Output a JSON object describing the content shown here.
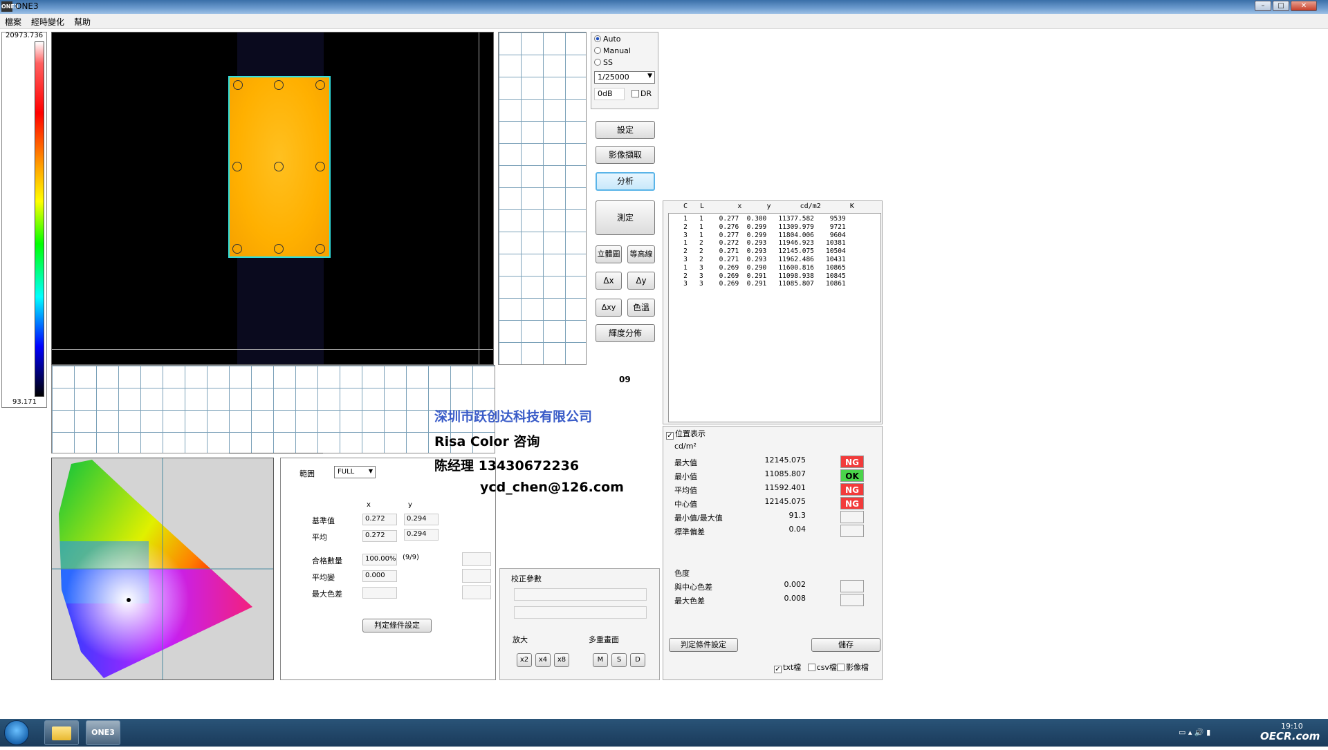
{
  "window": {
    "title": "ONE3",
    "icon": "ONE3"
  },
  "menu": [
    "檔案",
    "經時變化",
    "幫助"
  ],
  "scale": {
    "max": "20973.736",
    "min": "93.171"
  },
  "exposure": {
    "modes": [
      "Auto",
      "Manual",
      "SS"
    ],
    "selected_mode": "Auto",
    "shutter": "1/25000",
    "gain": "0dB",
    "dr_label": "DR"
  },
  "buttons": {
    "settings": "設定",
    "capture": "影像擷取",
    "analyze": "分析",
    "measure": "測定",
    "solid": "立體圖",
    "contour": "等高線",
    "dx": "Δx",
    "dy": "Δy",
    "dxy": "Δxy",
    "color_temp": "色溫",
    "lum_dist": "輝度分佈"
  },
  "count_label": "09",
  "table": {
    "headers": [
      "C",
      "L",
      "x",
      "y",
      "cd/m2",
      "K"
    ],
    "rows": [
      [
        "1",
        "1",
        "0.277",
        "0.300",
        "11377.582",
        "9539"
      ],
      [
        "2",
        "1",
        "0.276",
        "0.299",
        "11309.979",
        "9721"
      ],
      [
        "3",
        "1",
        "0.277",
        "0.299",
        "11804.006",
        "9604"
      ],
      [
        "1",
        "2",
        "0.272",
        "0.293",
        "11946.923",
        "10381"
      ],
      [
        "2",
        "2",
        "0.271",
        "0.293",
        "12145.075",
        "10504"
      ],
      [
        "3",
        "2",
        "0.271",
        "0.293",
        "11962.486",
        "10431"
      ],
      [
        "1",
        "3",
        "0.269",
        "0.290",
        "11600.816",
        "10865"
      ],
      [
        "2",
        "3",
        "0.269",
        "0.291",
        "11098.938",
        "10845"
      ],
      [
        "3",
        "3",
        "0.269",
        "0.291",
        "11085.807",
        "10861"
      ]
    ]
  },
  "stats": {
    "position_display": "位置表示",
    "unit": "cd/m²",
    "rows": [
      {
        "label": "最大值",
        "value": "12145.075",
        "status": "NG"
      },
      {
        "label": "最小值",
        "value": "11085.807",
        "status": "OK"
      },
      {
        "label": "平均值",
        "value": "11592.401",
        "status": "NG"
      },
      {
        "label": "中心值",
        "value": "12145.075",
        "status": "NG"
      },
      {
        "label": "最小值/最大值",
        "value": "91.3",
        "status": ""
      },
      {
        "label": "標準偏差",
        "value": "0.04",
        "status": ""
      }
    ],
    "chroma_title": "色度",
    "chroma_rows": [
      {
        "label": "與中心色差",
        "value": "0.002"
      },
      {
        "label": "最大色差",
        "value": "0.008"
      }
    ],
    "judge_button": "判定條件設定",
    "save_button": "儲存",
    "check_txt": "txt檔",
    "check_csv": "csv檔",
    "check_img": "影像檔"
  },
  "range_panel": {
    "range_label": "範囲",
    "range_value": "FULL",
    "col_x": "x",
    "col_y": "y",
    "base_label": "基準值",
    "base_x": "0.272",
    "base_y": "0.294",
    "avg_label": "平均",
    "avg_x": "0.272",
    "avg_y": "0.294",
    "pass_label": "合格數量",
    "pass_value": "100.00%",
    "pass_count": "(9/9)",
    "uniform_label": "平均變",
    "uniform_value": "0.000",
    "maxdiff_label": "最大色差",
    "judge_button": "判定條件設定"
  },
  "correction": {
    "title": "校正參數",
    "zoom_label": "放大",
    "zoom_buttons": [
      "x2",
      "x4",
      "x8"
    ],
    "multi_label": "多重畫面",
    "multi_buttons": [
      "M",
      "S",
      "D"
    ]
  },
  "watermark": {
    "line1": "深圳市跃创达科技有限公司",
    "line2": "Risa Color 咨询",
    "line3": "陈经理  13430672236",
    "line4": "ycd_chen@126.com",
    "color1": "#3a5cc8"
  },
  "taskbar": {
    "app_label": "ONE3",
    "time": "19:10",
    "site": "OECR.com"
  }
}
